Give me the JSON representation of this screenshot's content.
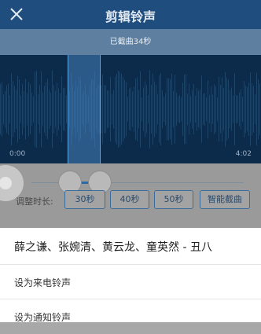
{
  "header": {
    "title": "剪辑铃声",
    "close_icon": "close-icon"
  },
  "subbar": {
    "text": "已截曲34秒"
  },
  "waveform": {
    "time_start": "0:00",
    "time_end": "4:02"
  },
  "adjust": {
    "label": "调整时长:",
    "options": [
      "30秒",
      "40秒",
      "50秒",
      "智能截曲"
    ]
  },
  "sheet": {
    "song_title": "薛之谦、张婉清、黄云龙、童英然 - 丑八",
    "items": [
      "设为来电铃声",
      "设为通知铃声"
    ]
  },
  "colors": {
    "header_bg": "#1f4e7e",
    "accent": "#2a6aa6",
    "wave_bg": "#0c2a49"
  }
}
